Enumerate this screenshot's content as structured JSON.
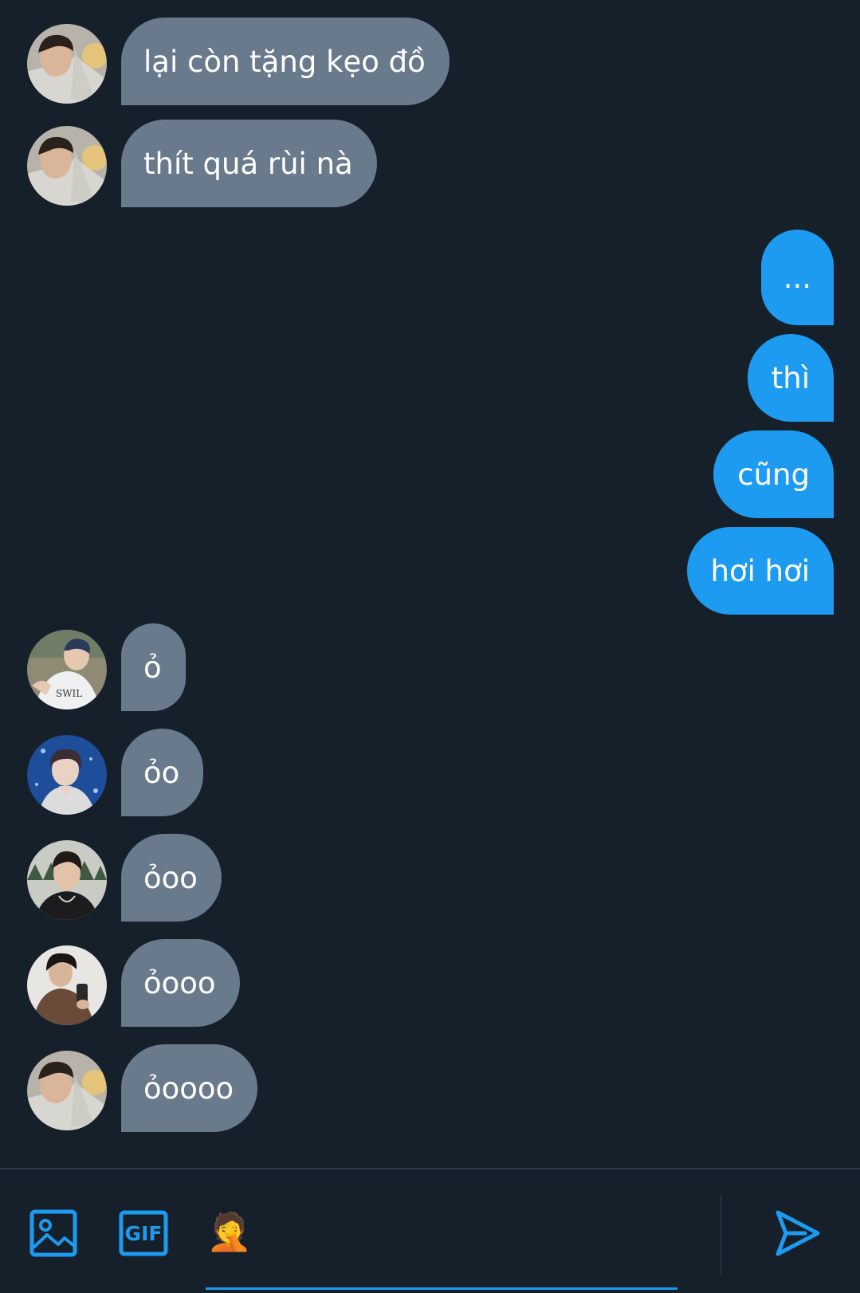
{
  "conversation": {
    "messages": [
      {
        "direction": "incoming",
        "text": "lại còn tặng kẹo đồ",
        "avatar": "avatar-a"
      },
      {
        "direction": "incoming",
        "text": "thít quá rùi nà",
        "avatar": "avatar-a"
      },
      {
        "direction": "outgoing",
        "text": "..."
      },
      {
        "direction": "outgoing",
        "text": "thì"
      },
      {
        "direction": "outgoing",
        "text": "cũng"
      },
      {
        "direction": "outgoing",
        "text": "hơi hơi"
      },
      {
        "direction": "incoming",
        "text": "ỏ",
        "avatar": "avatar-b"
      },
      {
        "direction": "incoming",
        "text": "ỏo",
        "avatar": "avatar-c"
      },
      {
        "direction": "incoming",
        "text": "ỏoo",
        "avatar": "avatar-d"
      },
      {
        "direction": "incoming",
        "text": "ỏooo",
        "avatar": "avatar-e"
      },
      {
        "direction": "incoming",
        "text": "ỏoooo",
        "avatar": "avatar-a"
      }
    ]
  },
  "composer": {
    "media_icon": "image-icon",
    "gif_label": "GIF",
    "emoji": "🤦",
    "send_icon": "send-icon",
    "placeholder": ""
  },
  "colors": {
    "background": "#15202b",
    "incoming_bubble": "#687a8c",
    "outgoing_bubble": "#1d9bf0",
    "accent": "#1d9bf0"
  }
}
